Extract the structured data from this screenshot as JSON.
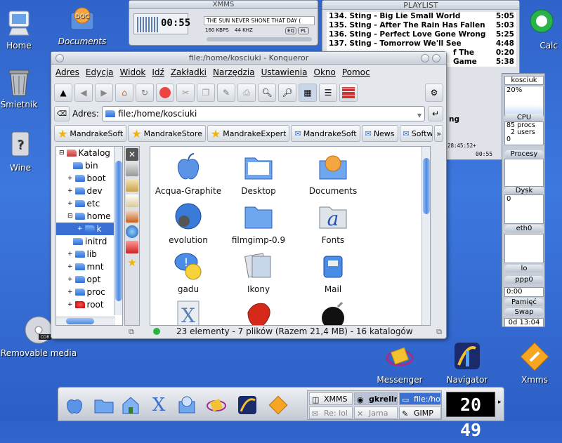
{
  "desktop": {
    "icons": [
      {
        "label": "Home"
      },
      {
        "label": "Documents"
      },
      {
        "label": "Śmietnik"
      },
      {
        "label": "Wine"
      },
      {
        "label": "Removable media"
      },
      {
        "label": "Messenger"
      },
      {
        "label": "Navigator"
      },
      {
        "label": "Xmms"
      },
      {
        "label": "Calc"
      }
    ]
  },
  "xmms": {
    "title": "XMMS",
    "time": "00:55",
    "scroll_text": "THE SUN NEVER SHONE THAT DAY (",
    "bitrate": "160 KBPS",
    "samplerate": "44 KHZ",
    "btn_eq": "EQ",
    "btn_pl": "PL"
  },
  "playlist": {
    "title": "PLAYLIST",
    "rows": [
      {
        "text": "134. Sting - Big Lie Small World",
        "time": "5:05"
      },
      {
        "text": "135. Sting - After The Rain Has Fallen",
        "time": "5:03"
      },
      {
        "text": "136. Sting - Perfect Love Gone Wrong",
        "time": "5:25"
      },
      {
        "text": "137. Sting - Tomorrow We'll See",
        "time": "4:48"
      },
      {
        "text": "f The Game",
        "time": "0:20"
      },
      {
        "text": "",
        "time": "5:38"
      }
    ],
    "partial_text": "ng",
    "total_time": "28:45:52+",
    "current": "00:55"
  },
  "konqueror": {
    "title": "file:/home/kosciuki - Konqueror",
    "menu": [
      "Adres",
      "Edycja",
      "Widok",
      "Idź",
      "Zakładki",
      "Narzędzia",
      "Ustawienia",
      "Okno",
      "Pomoc"
    ],
    "address_label": "Adres:",
    "address_value": "file:/home/kosciuki",
    "bookmarks": [
      "MandrakeSoft",
      "MandrakeStore",
      "MandrakeExpert",
      "MandrakeSoft",
      "News",
      "Softw"
    ],
    "tree": [
      {
        "label": "Katalog",
        "indent": 0
      },
      {
        "label": "bin",
        "indent": 1
      },
      {
        "label": "boot",
        "indent": 1
      },
      {
        "label": "dev",
        "indent": 1
      },
      {
        "label": "etc",
        "indent": 1
      },
      {
        "label": "home",
        "indent": 1
      },
      {
        "label": "k",
        "indent": 2
      },
      {
        "label": "initrd",
        "indent": 1
      },
      {
        "label": "lib",
        "indent": 1
      },
      {
        "label": "mnt",
        "indent": 1
      },
      {
        "label": "opt",
        "indent": 1
      },
      {
        "label": "proc",
        "indent": 1
      },
      {
        "label": "root",
        "indent": 1
      }
    ],
    "files": [
      {
        "label": "Acqua-Graphite",
        "icon": "apple-icon"
      },
      {
        "label": "Desktop",
        "icon": "folder-icon"
      },
      {
        "label": "Documents",
        "icon": "documents-icon"
      },
      {
        "label": "evolution",
        "icon": "evolution-icon"
      },
      {
        "label": "filmgimp-0.9",
        "icon": "folder-icon"
      },
      {
        "label": "Fonts",
        "icon": "fonts-icon"
      },
      {
        "label": "gadu",
        "icon": "gadu-icon"
      },
      {
        "label": "Ikony",
        "icon": "images-icon"
      },
      {
        "label": "Mail",
        "icon": "mail-icon"
      },
      {
        "label": "",
        "icon": "x-icon"
      },
      {
        "label": "",
        "icon": "gimp-icon"
      },
      {
        "label": "",
        "icon": "bomb-icon"
      }
    ],
    "status": "23 elementy - 7 plików (Razem  21,4 MB) - 16 katalogów"
  },
  "gkrellm": {
    "host": "kosciuk",
    "cpu_percent": "20%",
    "cpu_label": "CPU",
    "procs": "85 procs",
    "users": "2 users",
    "zero1": "0",
    "procesy": "Procesy",
    "dysk": "Dysk",
    "zero2": "0",
    "eth0": "eth0",
    "lo": "lo",
    "ppp0": "ppp0",
    "time_ppp": "0:00",
    "pamiec": "Pamięć",
    "swap": "Swap",
    "date": "0d 13:04"
  },
  "taskbar": {
    "tasks": [
      {
        "label": "XMMS"
      },
      {
        "label": "gkrellm"
      },
      {
        "label": "file:/ho"
      },
      {
        "label": "Re: lol"
      },
      {
        "label": "Jama"
      },
      {
        "label": "GIMP"
      }
    ],
    "clock": "20 49"
  }
}
